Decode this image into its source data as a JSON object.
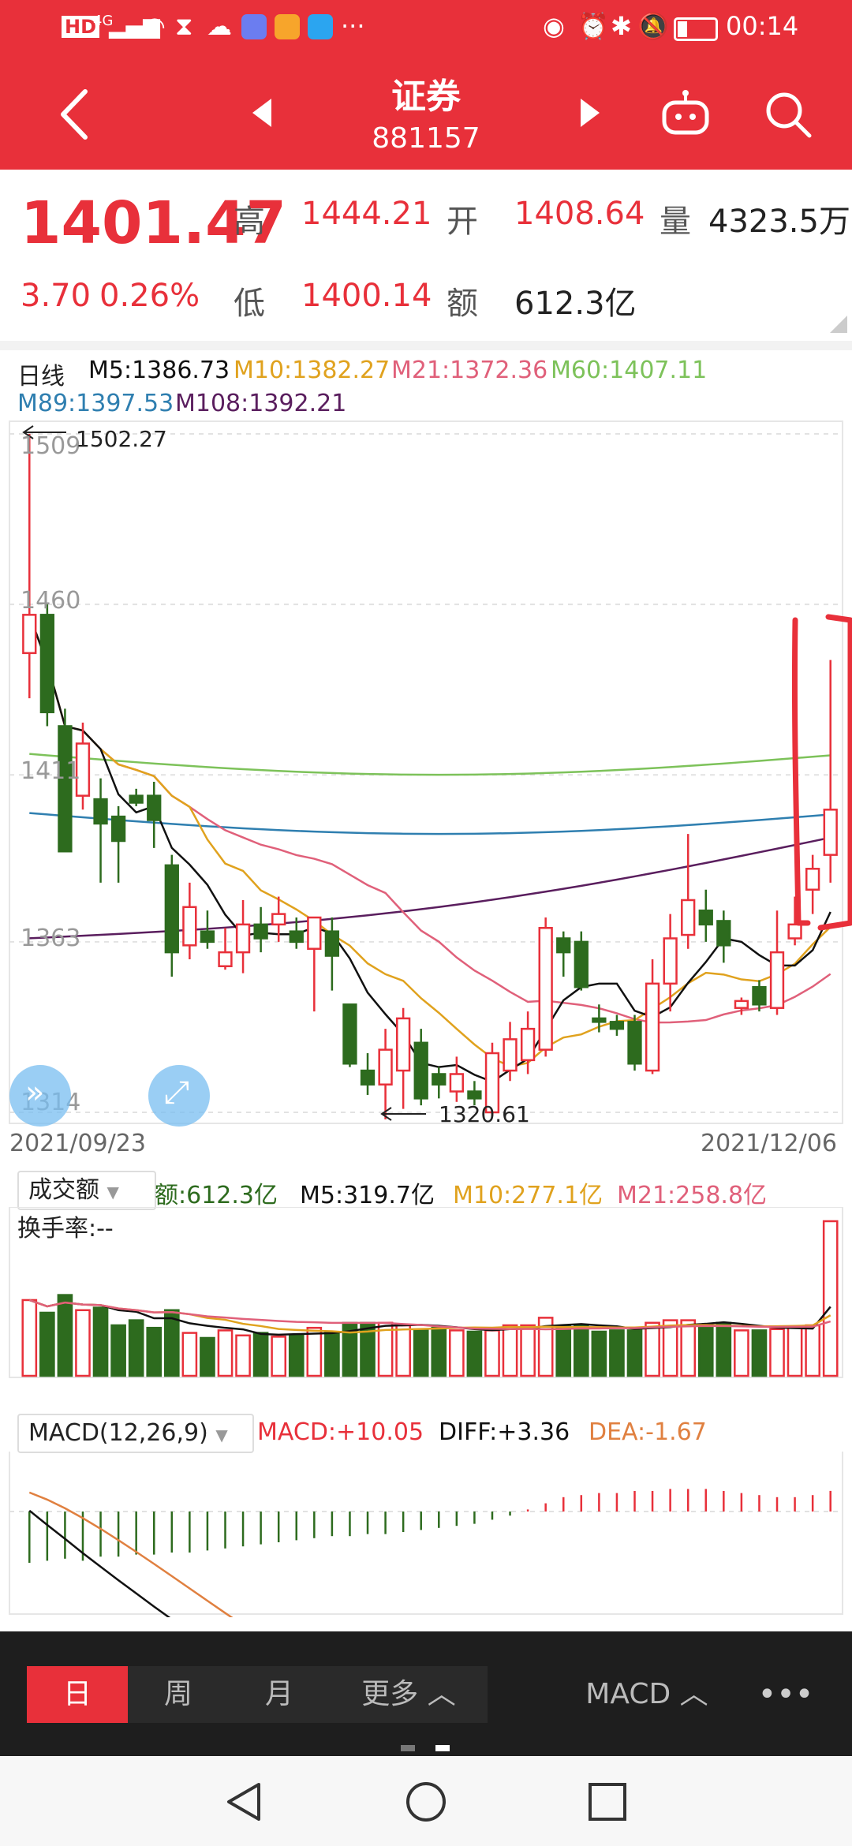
{
  "status": {
    "hd": "HD",
    "signal": "4G",
    "more": "···",
    "time": "00:14"
  },
  "header": {
    "title": "证券",
    "code": "881157"
  },
  "quote": {
    "price": "1401.47",
    "change": "3.70",
    "change_pct": "0.26%",
    "high_label": "高",
    "high": "1444.21",
    "open_label": "开",
    "open": "1408.64",
    "volume_label": "量",
    "volume": "4323.5万",
    "low_label": "低",
    "low": "1400.14",
    "amount_label": "额",
    "amount": "612.3亿"
  },
  "kline": {
    "period_label": "日线",
    "ma": {
      "m5": "M5:1386.73",
      "m10": "M10:1382.27",
      "m21": "M21:1372.36",
      "m60": "M60:1407.11",
      "m89": "M89:1397.53",
      "m108": "M108:1392.21"
    },
    "high_mark": "1502.27",
    "low_mark": "1320.61",
    "y_ticks": [
      "1509",
      "1460",
      "1411",
      "1363",
      "1314"
    ],
    "date_start": "2021/09/23",
    "date_end": "2021/12/06"
  },
  "volume_panel": {
    "selector": "成交额",
    "value": "额:612.3亿",
    "m5": "M5:319.7亿",
    "m10": "M10:277.1亿",
    "m21": "M21:258.8亿",
    "turnover": "换手率:--"
  },
  "macd_panel": {
    "selector": "MACD(12,26,9)",
    "macd": "MACD:+10.05",
    "diff": "DIFF:+3.36",
    "dea": "DEA:-1.67"
  },
  "tabs": {
    "day": "日",
    "week": "周",
    "month": "月",
    "more": "更多",
    "indicator": "MACD"
  },
  "colors": {
    "red": "#e8303a",
    "green": "#2d6b1e",
    "m5": "#111111",
    "m10": "#e0a21e",
    "m21": "#e0607a",
    "m60": "#7dc25a",
    "m89": "#2f7fb0",
    "m108": "#5a1e5e",
    "dea": "#e08040"
  },
  "chart_data": {
    "type": "candlestick",
    "y_ticks": [
      1509,
      1460,
      1411,
      1363,
      1314
    ],
    "ylim": [
      1314,
      1509
    ],
    "date_start": "2021/09/23",
    "date_end": "2021/12/06",
    "candles": [
      {
        "o": 1446,
        "c": 1457,
        "h": 1509,
        "l": 1433
      },
      {
        "o": 1457,
        "c": 1429,
        "h": 1460,
        "l": 1425
      },
      {
        "o": 1425,
        "c": 1389,
        "h": 1430,
        "l": 1389
      },
      {
        "o": 1405,
        "c": 1420,
        "h": 1426,
        "l": 1401
      },
      {
        "o": 1404,
        "c": 1397,
        "h": 1410,
        "l": 1380
      },
      {
        "o": 1399,
        "c": 1392,
        "h": 1402,
        "l": 1380
      },
      {
        "o": 1405,
        "c": 1403,
        "h": 1407,
        "l": 1402
      },
      {
        "o": 1405,
        "c": 1398,
        "h": 1409,
        "l": 1390
      },
      {
        "o": 1385,
        "c": 1360,
        "h": 1388,
        "l": 1353
      },
      {
        "o": 1362,
        "c": 1373,
        "h": 1380,
        "l": 1358
      },
      {
        "o": 1366,
        "c": 1363,
        "h": 1372,
        "l": 1361
      },
      {
        "o": 1356,
        "c": 1360,
        "h": 1367,
        "l": 1355
      },
      {
        "o": 1360,
        "c": 1368,
        "h": 1375,
        "l": 1354
      },
      {
        "o": 1368,
        "c": 1364,
        "h": 1373,
        "l": 1360
      },
      {
        "o": 1368,
        "c": 1371,
        "h": 1376,
        "l": 1363
      },
      {
        "o": 1366,
        "c": 1363,
        "h": 1370,
        "l": 1361
      },
      {
        "o": 1361,
        "c": 1370,
        "h": 1370,
        "l": 1343
      },
      {
        "o": 1366,
        "c": 1359,
        "h": 1370,
        "l": 1349
      },
      {
        "o": 1345,
        "c": 1328,
        "h": 1345,
        "l": 1327
      },
      {
        "o": 1326,
        "c": 1322,
        "h": 1331,
        "l": 1319
      },
      {
        "o": 1322,
        "c": 1332,
        "h": 1338,
        "l": 1312
      },
      {
        "o": 1326,
        "c": 1341,
        "h": 1344,
        "l": 1315
      },
      {
        "o": 1334,
        "c": 1318,
        "h": 1338,
        "l": 1316
      },
      {
        "o": 1325,
        "c": 1322,
        "h": 1327,
        "l": 1318
      },
      {
        "o": 1320,
        "c": 1325,
        "h": 1330,
        "l": 1317
      },
      {
        "o": 1320,
        "c": 1318,
        "h": 1323,
        "l": 1316
      },
      {
        "o": 1314,
        "c": 1331,
        "h": 1334,
        "l": 1313
      },
      {
        "o": 1326,
        "c": 1335,
        "h": 1340,
        "l": 1323
      },
      {
        "o": 1329,
        "c": 1338,
        "h": 1343,
        "l": 1325
      },
      {
        "o": 1332,
        "c": 1367,
        "h": 1370,
        "l": 1330
      },
      {
        "o": 1364,
        "c": 1360,
        "h": 1366,
        "l": 1353
      },
      {
        "o": 1363,
        "c": 1350,
        "h": 1366,
        "l": 1349
      },
      {
        "o": 1341,
        "c": 1340,
        "h": 1345,
        "l": 1337
      },
      {
        "o": 1340,
        "c": 1338,
        "h": 1342,
        "l": 1336
      },
      {
        "o": 1340,
        "c": 1328,
        "h": 1342,
        "l": 1326
      },
      {
        "o": 1326,
        "c": 1351,
        "h": 1358,
        "l": 1325
      },
      {
        "o": 1351,
        "c": 1364,
        "h": 1371,
        "l": 1343
      },
      {
        "o": 1365,
        "c": 1375,
        "h": 1394,
        "l": 1361
      },
      {
        "o": 1372,
        "c": 1368,
        "h": 1378,
        "l": 1363
      },
      {
        "o": 1369,
        "c": 1362,
        "h": 1372,
        "l": 1357
      },
      {
        "o": 1344,
        "c": 1346,
        "h": 1347,
        "l": 1342
      },
      {
        "o": 1350,
        "c": 1345,
        "h": 1352,
        "l": 1343
      },
      {
        "o": 1344,
        "c": 1360,
        "h": 1372,
        "l": 1342
      },
      {
        "o": 1364,
        "c": 1368,
        "h": 1376,
        "l": 1362
      },
      {
        "o": 1378,
        "c": 1384,
        "h": 1388,
        "l": 1371
      },
      {
        "o": 1388,
        "c": 1401,
        "h": 1444,
        "l": 1380
      }
    ],
    "volume_m": [
      300,
      250,
      320,
      260,
      270,
      200,
      220,
      190,
      260,
      170,
      150,
      180,
      160,
      170,
      155,
      160,
      190,
      170,
      210,
      210,
      210,
      200,
      180,
      190,
      180,
      175,
      180,
      200,
      200,
      230,
      195,
      200,
      175,
      180,
      180,
      210,
      220,
      220,
      200,
      210,
      180,
      180,
      185,
      190,
      200,
      612.3
    ],
    "macd_hist": [
      -25,
      -24,
      -23,
      -24,
      -22,
      -22,
      -21,
      -21,
      -20,
      -20,
      -19,
      -18,
      -17,
      -16,
      -15,
      -14,
      -13,
      -12,
      -12,
      -11,
      -11,
      -10,
      -9,
      -8,
      -7,
      -6,
      -4,
      -2,
      1,
      4,
      7,
      8,
      9,
      9,
      10,
      10,
      11,
      11,
      11,
      10,
      9,
      8,
      7,
      7,
      8,
      10.05
    ]
  }
}
